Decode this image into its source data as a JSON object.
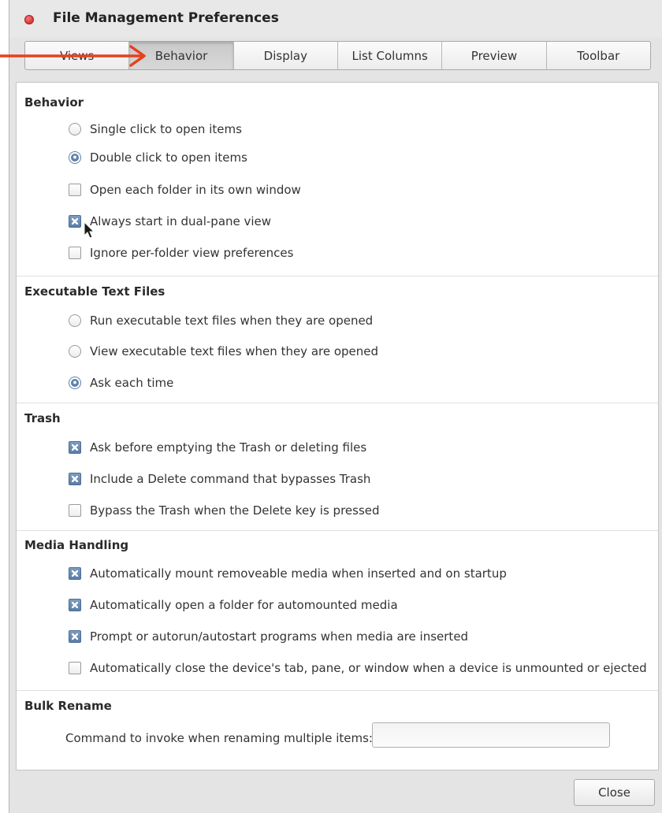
{
  "window": {
    "title": "File Management Preferences"
  },
  "tabs": [
    {
      "label": "Views",
      "active": false
    },
    {
      "label": "Behavior",
      "active": true
    },
    {
      "label": "Display",
      "active": false
    },
    {
      "label": "List Columns",
      "active": false
    },
    {
      "label": "Preview",
      "active": false
    },
    {
      "label": "Toolbar",
      "active": false
    }
  ],
  "behavior": {
    "title": "Behavior",
    "single_click": {
      "label": "Single click to open items",
      "selected": false
    },
    "double_click": {
      "label": "Double click to open items",
      "selected": true
    },
    "own_window": {
      "label": "Open each folder in its own window",
      "checked": false
    },
    "dual_pane": {
      "label": "Always start in dual-pane view",
      "checked": true
    },
    "ignore_prefs": {
      "label": "Ignore per-folder view preferences",
      "checked": false
    }
  },
  "executable": {
    "title": "Executable Text Files",
    "run": {
      "label": "Run executable text files when they are opened",
      "selected": false
    },
    "view": {
      "label": "View executable text files when they are opened",
      "selected": false
    },
    "ask": {
      "label": "Ask each time",
      "selected": true
    }
  },
  "trash": {
    "title": "Trash",
    "ask_before": {
      "label": "Ask before emptying the Trash or deleting files",
      "checked": true
    },
    "delete_cmd": {
      "label": "Include a Delete command that bypasses Trash",
      "checked": true
    },
    "bypass_key": {
      "label": "Bypass the Trash when the Delete key is pressed",
      "checked": false
    }
  },
  "media": {
    "title": "Media Handling",
    "automount": {
      "label": "Automatically mount removeable media when inserted and on startup",
      "checked": true
    },
    "open_folder": {
      "label": "Automatically open a folder for automounted media",
      "checked": true
    },
    "autorun": {
      "label": "Prompt or autorun/autostart programs when media are inserted",
      "checked": true
    },
    "close_tab": {
      "label": "Automatically close the device's tab, pane, or window when a device is unmounted or ejected",
      "checked": false
    }
  },
  "bulk_rename": {
    "title": "Bulk Rename",
    "command_label": "Command to invoke when renaming multiple items:",
    "command_value": ""
  },
  "buttons": {
    "close": "Close"
  },
  "colors": {
    "annotation_arrow": "#e8401c",
    "close_dot": "#dd3b3b",
    "check_accent": "#5a7ea8"
  },
  "icons": {
    "annotation": "arrow-right-icon",
    "pointer": "mouse-pointer-icon"
  }
}
